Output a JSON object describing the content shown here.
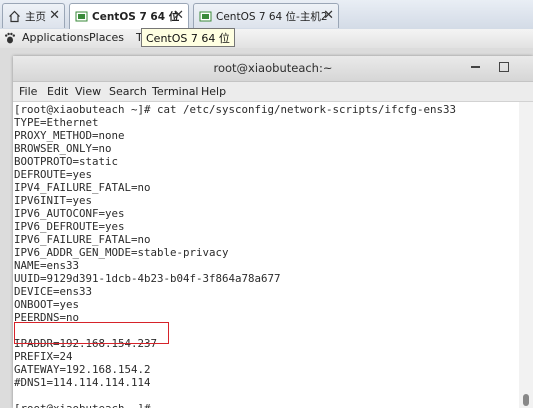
{
  "tabs": [
    {
      "label": "主页",
      "icon": "home-icon"
    },
    {
      "label": "CentOS 7 64 位",
      "icon": "vm-icon"
    },
    {
      "label": "CentOS 7 64 位-主机2",
      "icon": "vm-icon"
    }
  ],
  "tab_close": "✕",
  "gnome": {
    "applications": "Applications",
    "places": "Places",
    "truncated": "T"
  },
  "tooltip": "CentOS 7 64 位",
  "window": {
    "title": "root@xiaobuteach:~"
  },
  "menu": [
    "File",
    "Edit",
    "View",
    "Search",
    "Terminal",
    "Help"
  ],
  "terminal_lines": [
    "[root@xiaobuteach ~]# cat /etc/sysconfig/network-scripts/ifcfg-ens33",
    "TYPE=Ethernet",
    "PROXY_METHOD=none",
    "BROWSER_ONLY=no",
    "BOOTPROTO=static",
    "DEFROUTE=yes",
    "IPV4_FAILURE_FATAL=no",
    "IPV6INIT=yes",
    "IPV6_AUTOCONF=yes",
    "IPV6_DEFROUTE=yes",
    "IPV6_FAILURE_FATAL=no",
    "IPV6_ADDR_GEN_MODE=stable-privacy",
    "NAME=ens33",
    "UUID=9129d391-1dcb-4b23-b04f-3f864a78a677",
    "DEVICE=ens33",
    "ONBOOT=yes",
    "PEERDNS=no",
    "",
    "IPADDR=192.168.154.237",
    "PREFIX=24",
    "GATEWAY=192.168.154.2",
    "#DNS1=114.114.114.114",
    "",
    "[root@xiaobuteach ~]#"
  ],
  "colors": {
    "highlight": "#d6232a"
  }
}
